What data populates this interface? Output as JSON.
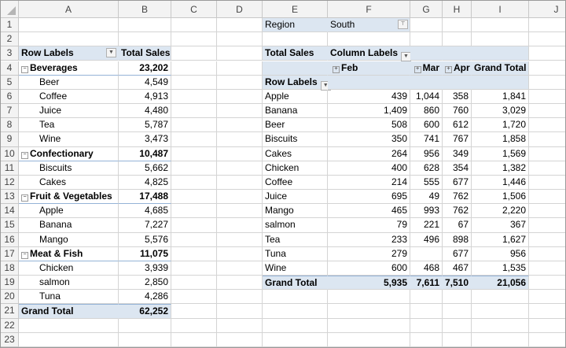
{
  "columns": [
    "A",
    "B",
    "C",
    "D",
    "E",
    "F",
    "G",
    "H",
    "I",
    "J"
  ],
  "rows": [
    "1",
    "2",
    "3",
    "4",
    "5",
    "6",
    "7",
    "8",
    "9",
    "10",
    "11",
    "12",
    "13",
    "14",
    "15",
    "16",
    "17",
    "18",
    "19",
    "20",
    "21",
    "22",
    "23"
  ],
  "pivot1": {
    "row_labels_header": "Row Labels",
    "value_header": "Total Sales",
    "groups": [
      {
        "name": "Beverages",
        "total": "23,202",
        "items": [
          [
            "Beer",
            "4,549"
          ],
          [
            "Coffee",
            "4,913"
          ],
          [
            "Juice",
            "4,480"
          ],
          [
            "Tea",
            "5,787"
          ],
          [
            "Wine",
            "3,473"
          ]
        ]
      },
      {
        "name": "Confectionary",
        "total": "10,487",
        "items": [
          [
            "Biscuits",
            "5,662"
          ],
          [
            "Cakes",
            "4,825"
          ]
        ]
      },
      {
        "name": "Fruit & Vegetables",
        "total": "17,488",
        "items": [
          [
            "Apple",
            "4,685"
          ],
          [
            "Banana",
            "7,227"
          ],
          [
            "Mango",
            "5,576"
          ]
        ]
      },
      {
        "name": "Meat & Fish",
        "total": "11,075",
        "items": [
          [
            "Chicken",
            "3,939"
          ],
          [
            "salmon",
            "2,850"
          ],
          [
            "Tuna",
            "4,286"
          ]
        ]
      }
    ],
    "grand_total_label": "Grand Total",
    "grand_total": "62,252"
  },
  "pivot2": {
    "filter_label": "Region",
    "filter_value": "South",
    "value_label": "Total Sales",
    "column_labels_header": "Column Labels",
    "row_labels_header": "Row Labels",
    "months": [
      "Feb",
      "Mar",
      "Apr"
    ],
    "grand_total_header": "Grand Total",
    "rows": [
      [
        "Apple",
        "439",
        "1,044",
        "358",
        "1,841"
      ],
      [
        "Banana",
        "1,409",
        "860",
        "760",
        "3,029"
      ],
      [
        "Beer",
        "508",
        "600",
        "612",
        "1,720"
      ],
      [
        "Biscuits",
        "350",
        "741",
        "767",
        "1,858"
      ],
      [
        "Cakes",
        "264",
        "956",
        "349",
        "1,569"
      ],
      [
        "Chicken",
        "400",
        "628",
        "354",
        "1,382"
      ],
      [
        "Coffee",
        "214",
        "555",
        "677",
        "1,446"
      ],
      [
        "Juice",
        "695",
        "49",
        "762",
        "1,506"
      ],
      [
        "Mango",
        "465",
        "993",
        "762",
        "2,220"
      ],
      [
        "salmon",
        "79",
        "221",
        "67",
        "367"
      ],
      [
        "Tea",
        "233",
        "496",
        "898",
        "1,627"
      ],
      [
        "Tuna",
        "279",
        "",
        "677",
        "956"
      ],
      [
        "Wine",
        "600",
        "468",
        "467",
        "1,535"
      ]
    ],
    "grand_total_label": "Grand Total",
    "grand_totals": [
      "5,935",
      "7,611",
      "7,510",
      "21,056"
    ]
  }
}
